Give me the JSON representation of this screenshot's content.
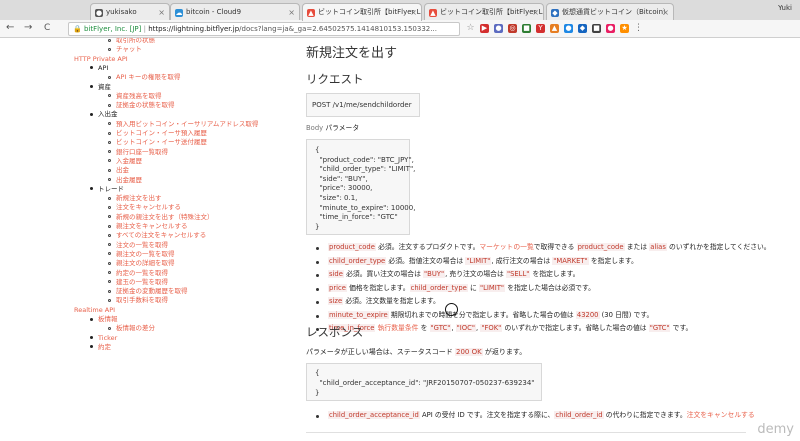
{
  "browser": {
    "tabs": [
      {
        "label": "yukisako",
        "icon_color": "#555555",
        "icon_glyph": "●",
        "active": false
      },
      {
        "label": "bitcoin - Cloud9",
        "icon_color": "#2c8fd6",
        "icon_glyph": "☁",
        "active": false
      },
      {
        "label": "ビットコイン取引所【bitFlyer Lig",
        "icon_color": "#e74c3c",
        "icon_glyph": "▲",
        "active": true
      },
      {
        "label": "ビットコイン取引所【bitFlyer Lig",
        "icon_color": "#e74c3c",
        "icon_glyph": "▲",
        "active": false
      },
      {
        "label": "仮想通貨ビットコイン（Bitcoin）",
        "icon_color": "#2c6fbf",
        "icon_glyph": "◆",
        "active": false
      }
    ],
    "tab_close": "×",
    "user": "Yuki",
    "nav": {
      "back": "←",
      "forward": "→",
      "reload": "C"
    },
    "secure_label": "bitFlyer, Inc. [JP]",
    "url_host": "https://lightning.bitflyer.jp",
    "url_path": "/docs?lang=ja&_ga=2.64502575.1414810153.150332...",
    "ext_icons": [
      {
        "glyph": "☆",
        "color": "#888888"
      },
      {
        "glyph": "▶",
        "color": "#d32f2f"
      },
      {
        "glyph": "●",
        "color": "#5c6bc0"
      },
      {
        "glyph": "◎",
        "color": "#c0392b"
      },
      {
        "glyph": "■",
        "color": "#2e7d32"
      },
      {
        "glyph": "Y",
        "color": "#d32f2f"
      },
      {
        "glyph": "▲",
        "color": "#e67e22"
      },
      {
        "glyph": "●",
        "color": "#1e88e5"
      },
      {
        "glyph": "◆",
        "color": "#1565c0"
      },
      {
        "glyph": "■",
        "color": "#424242"
      },
      {
        "glyph": "●",
        "color": "#e91e63"
      },
      {
        "glyph": "★",
        "color": "#ff8f00"
      },
      {
        "glyph": "⋮",
        "color": "#666666"
      }
    ]
  },
  "sidebar": {
    "items": [
      {
        "text": "取引所の状態",
        "kind": "link",
        "level": 2
      },
      {
        "text": "チャット",
        "kind": "link",
        "level": 2
      },
      {
        "text": "HTTP Private API",
        "kind": "head",
        "level": 0
      },
      {
        "text": "API",
        "kind": "plain",
        "level": 1
      },
      {
        "text": "API キーの権限を取得",
        "kind": "link",
        "level": 2
      },
      {
        "text": "資産",
        "kind": "plain",
        "level": 1
      },
      {
        "text": "資産残高を取得",
        "kind": "link",
        "level": 2
      },
      {
        "text": "証拠金の状態を取得",
        "kind": "link",
        "level": 2
      },
      {
        "text": "入出金",
        "kind": "plain",
        "level": 1
      },
      {
        "text": "預入用ビットコイン・イーサリアムアドレス取得",
        "kind": "link",
        "level": 2
      },
      {
        "text": "ビットコイン・イーサ預入履歴",
        "kind": "link",
        "level": 2
      },
      {
        "text": "ビットコイン・イーサ送付履歴",
        "kind": "link",
        "level": 2
      },
      {
        "text": "銀行口座一覧取得",
        "kind": "link",
        "level": 2
      },
      {
        "text": "入金履歴",
        "kind": "link",
        "level": 2
      },
      {
        "text": "出金",
        "kind": "link",
        "level": 2
      },
      {
        "text": "出金履歴",
        "kind": "link",
        "level": 2
      },
      {
        "text": "トレード",
        "kind": "plain",
        "level": 1
      },
      {
        "text": "新規注文を出す",
        "kind": "link",
        "level": 2
      },
      {
        "text": "注文をキャンセルする",
        "kind": "link",
        "level": 2
      },
      {
        "text": "新規の親注文を出す（特殊注文）",
        "kind": "link",
        "level": 2
      },
      {
        "text": "親注文をキャンセルする",
        "kind": "link",
        "level": 2
      },
      {
        "text": "すべての注文をキャンセルする",
        "kind": "link",
        "level": 2
      },
      {
        "text": "注文の一覧を取得",
        "kind": "link",
        "level": 2
      },
      {
        "text": "親注文の一覧を取得",
        "kind": "link",
        "level": 2
      },
      {
        "text": "親注文の詳細を取得",
        "kind": "link",
        "level": 2
      },
      {
        "text": "約定の一覧を取得",
        "kind": "link",
        "level": 2
      },
      {
        "text": "建玉の一覧を取得",
        "kind": "link",
        "level": 2
      },
      {
        "text": "証拠金の変動履歴を取得",
        "kind": "link",
        "level": 2
      },
      {
        "text": "取引手数料を取得",
        "kind": "link",
        "level": 2
      },
      {
        "text": "Realtime API",
        "kind": "head",
        "level": 0
      },
      {
        "text": "板情報",
        "kind": "link",
        "level": 1
      },
      {
        "text": "板情報の差分",
        "kind": "link",
        "level": 2
      },
      {
        "text": "Ticker",
        "kind": "link",
        "level": 1
      },
      {
        "text": "約定",
        "kind": "link",
        "level": 1
      }
    ]
  },
  "main": {
    "title": "新規注文を出す",
    "request_heading": "リクエスト",
    "endpoint": "POST /v1/me/sendchildorder",
    "body_label_prefix": "Body",
    "body_label_suffix": "パラメータ",
    "body_lines": [
      "{",
      "  \"product_code\": \"BTC_JPY\",",
      "  \"child_order_type\": \"LIMIT\",",
      "  \"side\": \"BUY\",",
      "  \"price\": 30000,",
      "  \"size\": 0.1,",
      "  \"minute_to_expire\": 10000,",
      "  \"time_in_force\": \"GTC\"",
      "}"
    ],
    "params": [
      {
        "key": "product_code",
        "parts": [
          " 必須。注文するプロダクトです。",
          "マーケットの一覧",
          "で取得できる ",
          "product_code",
          " または ",
          "alias",
          " のいずれかを指定してください。"
        ]
      },
      {
        "key": "child_order_type",
        "parts": [
          " 必須。指値注文の場合は ",
          "\"LIMIT\"",
          ", 成行注文の場合は ",
          "\"MARKET\"",
          " を指定します。"
        ]
      },
      {
        "key": "side",
        "parts": [
          " 必須。買い注文の場合は ",
          "\"BUY\"",
          ", 売り注文の場合は ",
          "\"SELL\"",
          " を指定します。"
        ]
      },
      {
        "key": "price",
        "parts": [
          " 価格を指定します。",
          "child_order_type",
          " に ",
          "\"LIMIT\"",
          " を指定した場合は必須です。"
        ]
      },
      {
        "key": "size",
        "parts": [
          " 必須。注文数量を指定します。"
        ]
      },
      {
        "key": "minute_to_expire",
        "parts": [
          " 期限切れまでの時間を分で指定します。省略した場合の値は ",
          "43200",
          " (30 日間) です。"
        ]
      },
      {
        "key": "time_in_force",
        "parts": [
          " ",
          "執行数量条件",
          " を ",
          "\"GTC\"",
          ", ",
          "\"IOC\"",
          ", ",
          "\"FOK\"",
          " のいずれかで指定します。省略した場合の値は ",
          "\"GTC\"",
          " です。"
        ]
      }
    ],
    "response_heading": "レスポンス",
    "response_text_1": "パラメータが正しい場合は、ステータスコード ",
    "response_code": "200 OK",
    "response_text_2": " が返ります。",
    "response_lines": [
      "{",
      "  \"child_order_acceptance_id\": \"JRF20150707-050237-639234\"",
      "}"
    ],
    "resp_param_key": "child_order_acceptance_id",
    "resp_param_parts": [
      " API の受付 ID です。注文を指定する際に、",
      "child_order_id",
      " の代わりに指定できます。",
      "注文をキャンセルする"
    ]
  },
  "watermark": "demy"
}
